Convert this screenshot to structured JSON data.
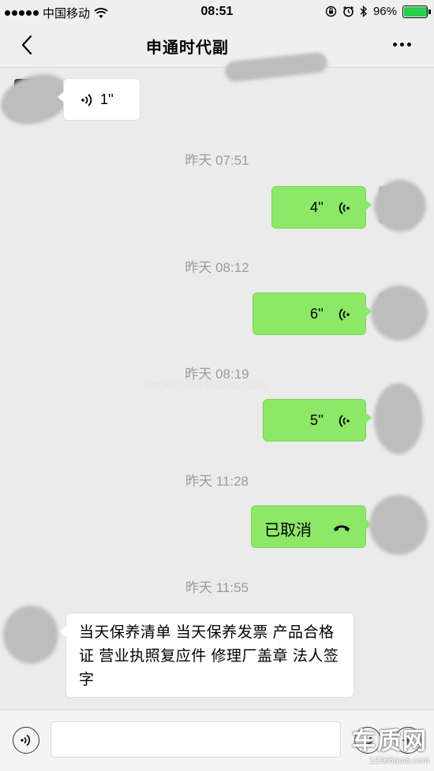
{
  "status_bar": {
    "carrier": "中国移动",
    "time": "08:51",
    "battery_percent": "96%",
    "battery_level": 0.96
  },
  "nav": {
    "title": "申通时代副",
    "back_icon": "chevron-left-icon",
    "more_icon": "more-dots-icon"
  },
  "messages": [
    {
      "direction": "in",
      "type": "voice",
      "duration": "1''"
    },
    {
      "time": "昨天 07:51"
    },
    {
      "direction": "out",
      "type": "voice",
      "duration": "4''"
    },
    {
      "time": "昨天 08:12"
    },
    {
      "direction": "out",
      "type": "voice",
      "duration": "6''"
    },
    {
      "time": "昨天 08:19"
    },
    {
      "direction": "out",
      "type": "voice",
      "duration": "5''"
    },
    {
      "time": "昨天 11:28"
    },
    {
      "direction": "out",
      "type": "call",
      "text": "已取消"
    },
    {
      "time": "昨天 11:55"
    },
    {
      "direction": "in",
      "type": "text",
      "text": "当天保养清单 当天保养发票 产品合格证 营业执照复应件 修理厂盖章 法人签字"
    }
  ],
  "watermark": {
    "site": "www.12365auto.com",
    "logo_text": "车质网",
    "logo_sub": "12365auto.com"
  },
  "input_bar": {
    "value": "",
    "voice_icon": "voice-mode-icon",
    "emoji_icon": "emoji-icon",
    "plus_icon": "plus-icon"
  },
  "colors": {
    "outgoing_bubble": "#8ce866",
    "incoming_bubble": "#ffffff",
    "background": "#ebebeb",
    "timestamp": "#9a9a9a"
  }
}
